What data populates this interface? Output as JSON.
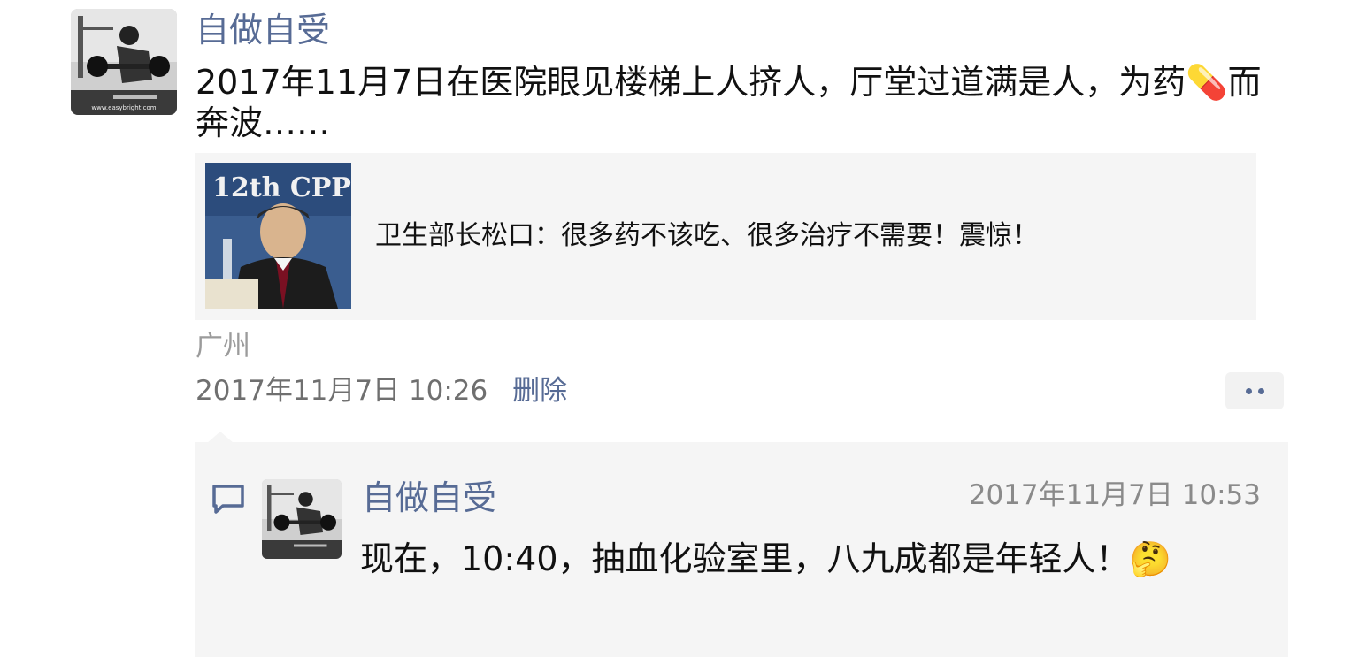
{
  "post": {
    "author": "自做自受",
    "text": "2017年11月7日在医院眼见楼梯上人挤人，厅堂过道满是人，为药💊而奔波……",
    "link_card": {
      "title": "卫生部长松口：很多药不该吃、很多治疗不需要！震惊！",
      "thumbnail_caption": "12th CPP"
    },
    "location": "广州",
    "timestamp": "2017年11月7日 10:26",
    "delete_label": "删除",
    "avatar_watermark": "www.easybright.com"
  },
  "comment": {
    "author": "自做自受",
    "time": "2017年11月7日 10:53",
    "text": "现在，10:40，抽血化验室里，八九成都是年轻人！🤔"
  },
  "colors": {
    "link_blue": "#576b95",
    "secondary_gray": "#9b9b9b",
    "card_bg": "#f5f5f5"
  },
  "icons": [
    "comment-bubble-icon",
    "more-dots-icon"
  ]
}
